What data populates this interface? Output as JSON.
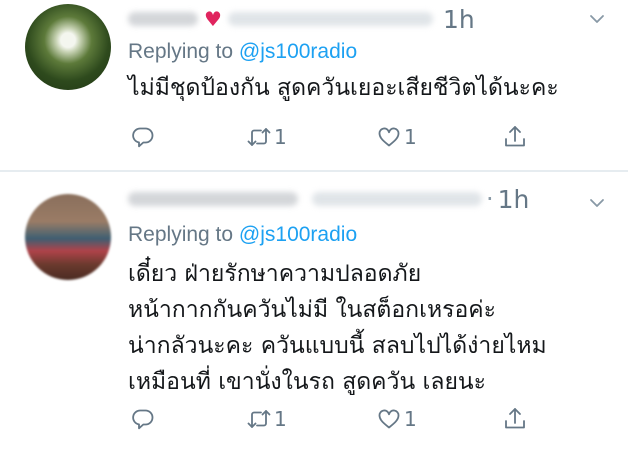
{
  "colors": {
    "text": "#14171a",
    "secondary": "#657786",
    "link": "#1da1f2",
    "heart": "#e0245e",
    "divider": "#e6ecf0"
  },
  "tweets": [
    {
      "author_emoji": "♥",
      "time": "1h",
      "reply_prefix": "Replying to ",
      "reply_mention": "@js100radio",
      "lines": [
        "ไม่มีชุดป้องกัน สูดควันเยอะเสียชีวิตได้นะคะ"
      ],
      "retweets": "1",
      "likes": "1",
      "icons": [
        "reply-icon",
        "retweet-icon",
        "heart-outline-icon",
        "share-icon",
        "chevron-down-icon"
      ]
    },
    {
      "separator": "·",
      "time": "1h",
      "reply_prefix": "Replying to ",
      "reply_mention": "@js100radio",
      "lines": [
        "เดี๋ยว ฝ่ายรักษาความปลอดภัย",
        "หน้ากากกันควันไม่มี ในสต็อกเหรอค่ะ",
        "น่ากลัวนะคะ ควันแบบนี้ สลบไปได้ง่ายไหม",
        "เหมือนที่ เขานั่งในรถ สูดควัน เลยนะ"
      ],
      "retweets": "1",
      "likes": "1",
      "icons": [
        "reply-icon",
        "retweet-icon",
        "heart-outline-icon",
        "share-icon",
        "chevron-down-icon"
      ]
    }
  ]
}
